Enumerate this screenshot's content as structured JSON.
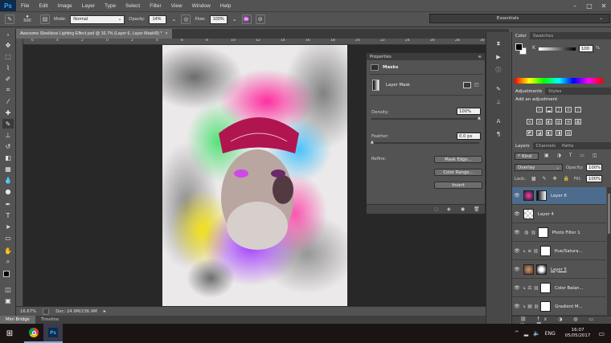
{
  "app": {
    "logo": "Ps"
  },
  "menu": {
    "items": [
      "File",
      "Edit",
      "Image",
      "Layer",
      "Type",
      "Select",
      "Filter",
      "View",
      "Window",
      "Help"
    ]
  },
  "window_controls": {
    "minimize": "–",
    "maximize": "□",
    "close": "✕"
  },
  "options_bar": {
    "brush_size": "500",
    "mode_label": "Mode:",
    "mode_value": "Normal",
    "opacity_label": "Opacity:",
    "opacity_value": "14%",
    "flow_label": "Flow:",
    "flow_value": "100%"
  },
  "workspace": {
    "value": "Essentials"
  },
  "document": {
    "tab_title": "Awesome Sleekless Lighting Effect.psd @ 16.7% (Layer 6, Layer Mask/8) *",
    "tab_close": "×"
  },
  "ruler": {
    "top_labels": [
      "6",
      "4",
      "2",
      "0",
      "2",
      "4",
      "6",
      "8",
      "10",
      "12",
      "14",
      "16",
      "18",
      "20",
      "22",
      "24",
      "26",
      "28",
      "30"
    ]
  },
  "status": {
    "zoom": "16.67%",
    "doc_info": "Doc: 24.9M/236.9M"
  },
  "bottom_tabs": [
    "Mini Bridge",
    "Timeline"
  ],
  "properties": {
    "title": "Properties",
    "section": "Masks",
    "mask_name": "Layer Mask",
    "density_label": "Density:",
    "density_value": "100%",
    "feather_label": "Feather:",
    "feather_value": "0.0 px",
    "refine_label": "Refine:",
    "mask_edge_button": "Mask Edge...",
    "color_range_button": "Color Range...",
    "invert_button": "Invert"
  },
  "color_panel": {
    "tabs": [
      "Color",
      "Swatches"
    ],
    "value": "100",
    "pct": "%"
  },
  "adjustments_panel": {
    "tabs": [
      "Adjustments",
      "Styles"
    ],
    "heading": "Add an adjustment"
  },
  "layers_panel": {
    "tabs": [
      "Layers",
      "Channels",
      "Paths"
    ],
    "kind_label": "Kind",
    "blend_mode": "Overlay",
    "opacity_label": "Opacity:",
    "opacity_value": "100%",
    "lock_label": "Lock:",
    "fill_label": "Fill:",
    "fill_value": "100%",
    "layers": [
      {
        "name": "Layer 6"
      },
      {
        "name": "Layer 4"
      },
      {
        "name": "Photo Filter 1"
      },
      {
        "name": "Hue/Satura..."
      },
      {
        "name": "Layer 5"
      },
      {
        "name": "Color Balan..."
      },
      {
        "name": "Gradient M..."
      }
    ]
  },
  "taskbar": {
    "lang": "ENG",
    "time": "16:07",
    "date": "05/05/2017"
  },
  "colors": {
    "accent": "#4d6b8c",
    "taskbar": "#1b1414",
    "canvas_bg": "#282828"
  }
}
